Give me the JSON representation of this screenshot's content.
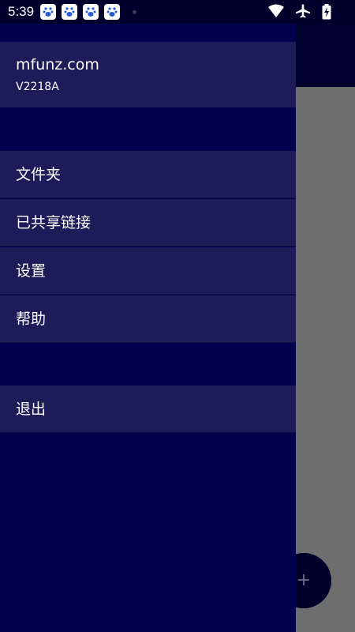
{
  "status_bar": {
    "time": "5:39",
    "notification_icons": [
      "baidu-icon",
      "baidu-icon",
      "baidu-icon",
      "baidu-icon"
    ],
    "right_icons": [
      "wifi-icon",
      "airplane-icon",
      "battery-charging-icon"
    ]
  },
  "drawer": {
    "header": {
      "title": "mfunz.com",
      "subtitle": "V2218A"
    },
    "menu": {
      "folders": "文件夹",
      "shared_links": "已共享链接",
      "settings": "设置",
      "help": "帮助",
      "logout": "退出"
    }
  },
  "fab": {
    "label": "+"
  },
  "colors": {
    "drawer_bg": "#00004f",
    "item_bg": "#1c1c58",
    "scrim": "#6e6e6e",
    "status_bar": "#00002a"
  }
}
